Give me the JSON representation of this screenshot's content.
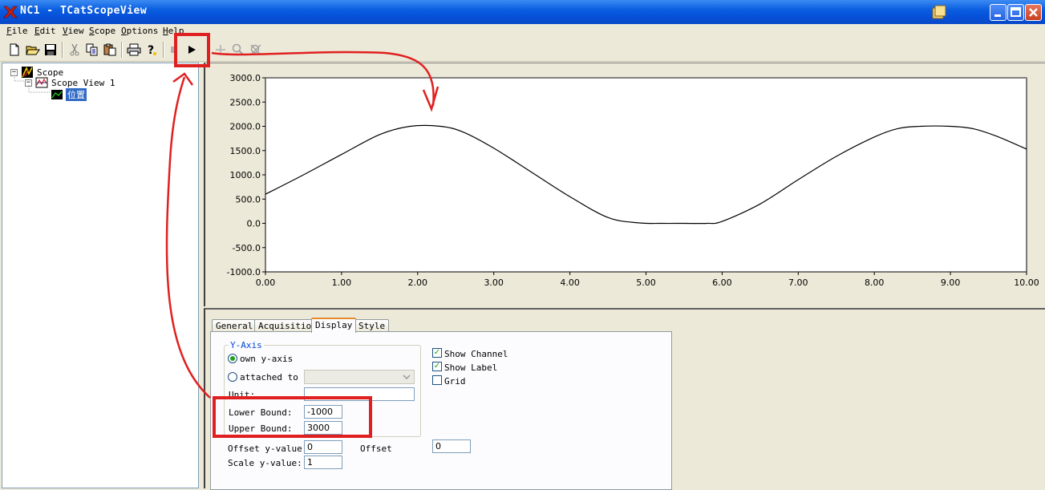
{
  "window": {
    "title": "NC1 - TCatScopeView",
    "controls": [
      "minimize-icon",
      "maximize-icon",
      "close-icon"
    ],
    "accent": "#0a5ee0"
  },
  "menu": [
    {
      "label": "File",
      "ul": "F",
      "rest": "ile"
    },
    {
      "label": "Edit",
      "ul": "E",
      "rest": "dit"
    },
    {
      "label": "View",
      "ul": "V",
      "rest": "iew"
    },
    {
      "label": "Scope",
      "ul": "S",
      "rest": "cope"
    },
    {
      "label": "Options",
      "ul": "O",
      "rest": "ptions"
    },
    {
      "label": "Help",
      "ul": "H",
      "rest": "elp"
    }
  ],
  "toolbar": {
    "icons": [
      "new-icon",
      "open-icon",
      "save-icon",
      "cut-icon",
      "copy-icon",
      "paste-icon",
      "print-icon",
      "help-icon",
      "stop-icon",
      "start-icon",
      "crosshair-icon",
      "zoom-icon",
      "zoom-reset-icon"
    ],
    "highlighted": "start-icon"
  },
  "tree": {
    "root": "Scope",
    "view": "Scope View 1",
    "channel": "位置"
  },
  "chart_data": {
    "type": "line",
    "title": "",
    "xlabel": "",
    "ylabel": "",
    "xlim": [
      0,
      10
    ],
    "ylim": [
      -1000,
      3000
    ],
    "xticks": [
      "0.00",
      "1.00",
      "2.00",
      "3.00",
      "4.00",
      "5.00",
      "6.00",
      "7.00",
      "8.00",
      "9.00",
      "10.00"
    ],
    "yticks": [
      "3000.0",
      "2500.0",
      "2000.0",
      "1500.0",
      "1000.0",
      "500.0",
      "0.0",
      "-500.0",
      "-1000.0"
    ],
    "grid": false,
    "series": [
      {
        "color": "#000000",
        "x": [
          0.0,
          0.5,
          1.0,
          1.5,
          1.9,
          2.3,
          2.6,
          3.0,
          3.5,
          4.0,
          4.5,
          4.9,
          5.2,
          5.5,
          5.8,
          6.0,
          6.5,
          7.0,
          7.5,
          8.0,
          8.3,
          8.6,
          9.0,
          9.3,
          9.6,
          10.0
        ],
        "y": [
          600,
          1000,
          1420,
          1830,
          2000,
          2000,
          1880,
          1550,
          1050,
          550,
          120,
          10,
          0,
          0,
          0,
          40,
          400,
          900,
          1380,
          1780,
          1950,
          2000,
          2000,
          1950,
          1800,
          1530
        ]
      }
    ]
  },
  "tabs": [
    "General",
    "Acquisition",
    "Display",
    "Style"
  ],
  "active_tab": "Display",
  "display": {
    "group_title": "Y-Axis",
    "own_axis_label": "own y-axis",
    "attached_label": "attached to",
    "unit_label": "Unit:",
    "unit_value": "",
    "lower_label": "Lower Bound:",
    "lower_value": "-1000",
    "upper_label": "Upper Bound:",
    "upper_value": "3000",
    "offset_y_label": "Offset y-value:",
    "offset_y_value": "0",
    "scale_y_label": "Scale y-value:",
    "scale_y_value": "1",
    "offset_label": "Offset",
    "offset_value": "0",
    "show_channel_label": "Show Channel",
    "show_channel_checked": true,
    "show_label_label": "Show Label",
    "show_label_checked": true,
    "grid_label": "Grid",
    "grid_checked": false
  },
  "annotation_color": "#e02020"
}
